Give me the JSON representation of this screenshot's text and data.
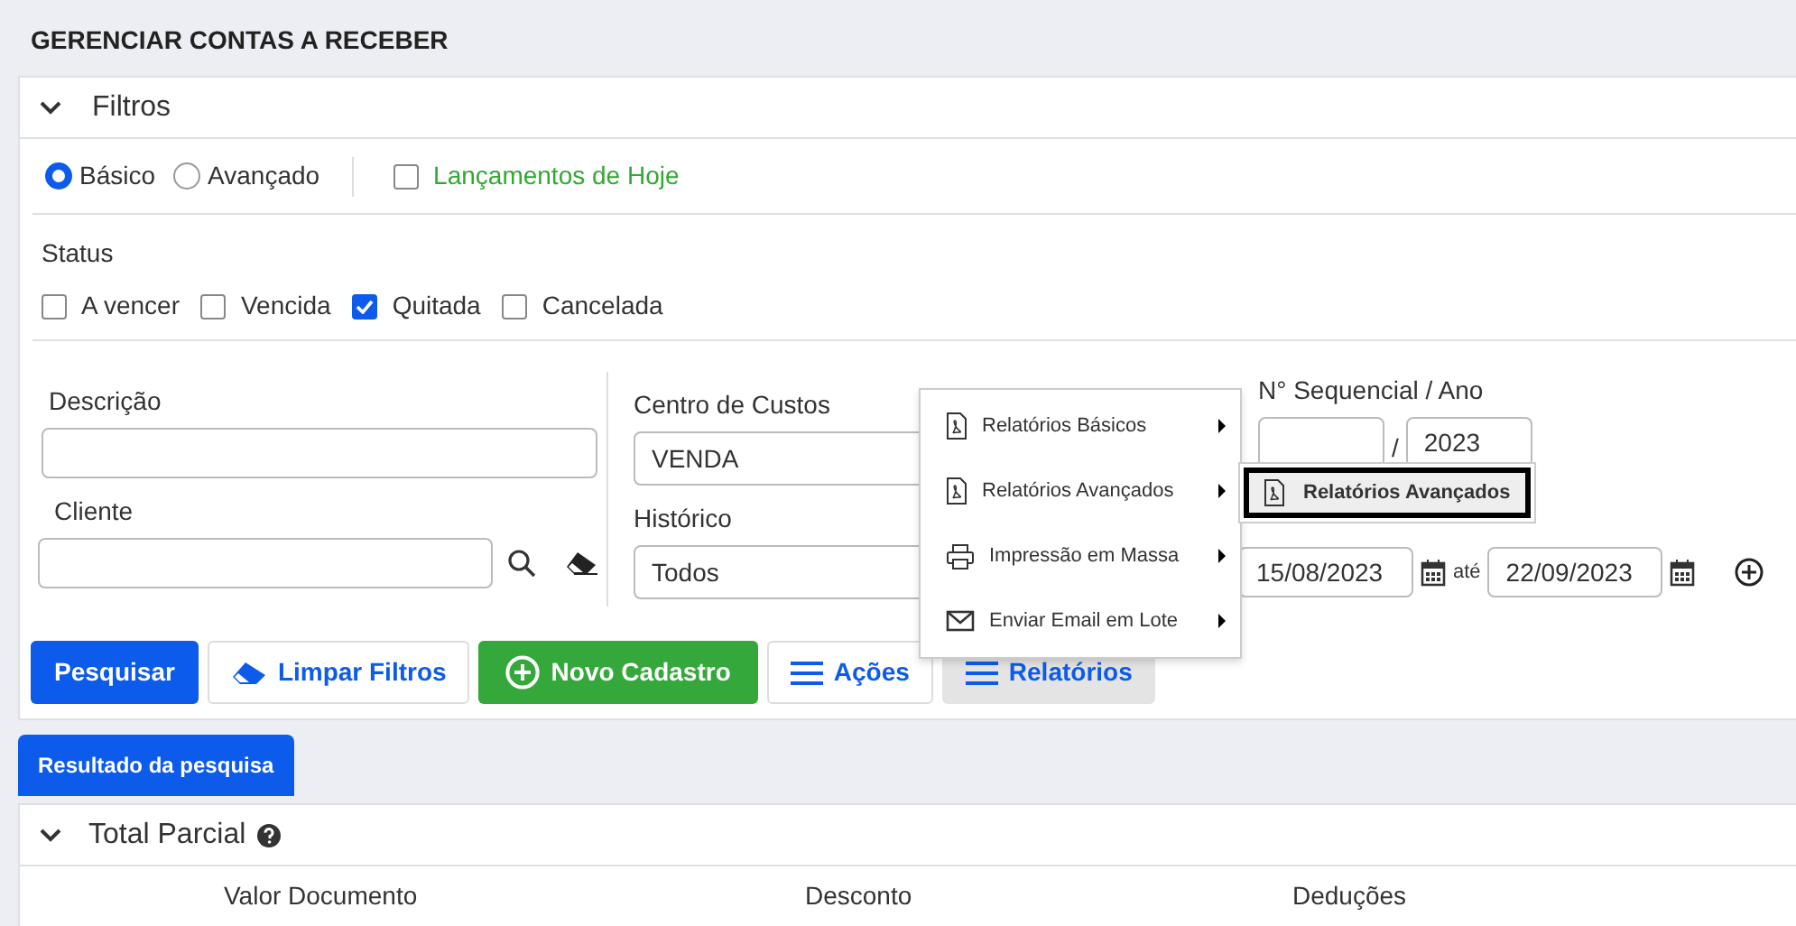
{
  "page_title": "GERENCIAR CONTAS A RECEBER",
  "filters": {
    "title": "Filtros",
    "expanded": true,
    "modes": [
      {
        "label": "Básico",
        "selected": true
      },
      {
        "label": "Avançado",
        "selected": false
      }
    ],
    "today": {
      "label": "Lançamentos de Hoje",
      "checked": false
    },
    "status_label": "Status",
    "statuses": [
      {
        "label": "A vencer",
        "checked": false
      },
      {
        "label": "Vencida",
        "checked": false
      },
      {
        "label": "Quitada",
        "checked": true
      },
      {
        "label": "Cancelada",
        "checked": false
      }
    ],
    "descricao": {
      "label": "Descrição"
    },
    "cliente": {
      "label": "Cliente"
    },
    "centro_custos": {
      "label": "Centro de Custos",
      "value": "VENDA"
    },
    "historico": {
      "label": "Histórico",
      "value": "Todos"
    },
    "sequencial": {
      "label": "N° Sequencial / Ano",
      "separator": "/",
      "year": "2023"
    },
    "periodo": {
      "from": "15/08/2023",
      "until_label": "até",
      "to": "22/09/2023"
    }
  },
  "buttons": [
    {
      "label": "Pesquisar",
      "kind": "primary",
      "selected": false
    },
    {
      "label": "Limpar Filtros",
      "kind": "eraser",
      "selected": false
    },
    {
      "label": "Novo Cadastro",
      "kind": "new",
      "selected": false
    },
    {
      "label": "Ações",
      "kind": "menu",
      "selected": false
    },
    {
      "label": "Relatórios",
      "kind": "menu",
      "selected": true
    }
  ],
  "reports_menu": [
    {
      "label": "Relatórios Básicos",
      "kind": "pdf"
    },
    {
      "label": "Relatórios Avançados",
      "kind": "pdf"
    },
    {
      "label": "Impressão em Massa",
      "kind": "printer"
    },
    {
      "label": "Enviar Email em Lote",
      "kind": "mail"
    }
  ],
  "submenu": [
    {
      "label": "Relatórios Avançados",
      "kind": "pdf",
      "selected": true
    }
  ],
  "result_tab": "Resultado da pesquisa",
  "total": {
    "title": "Total Parcial",
    "columns": [
      "Valor Documento",
      "Desconto",
      "Deduções"
    ]
  }
}
